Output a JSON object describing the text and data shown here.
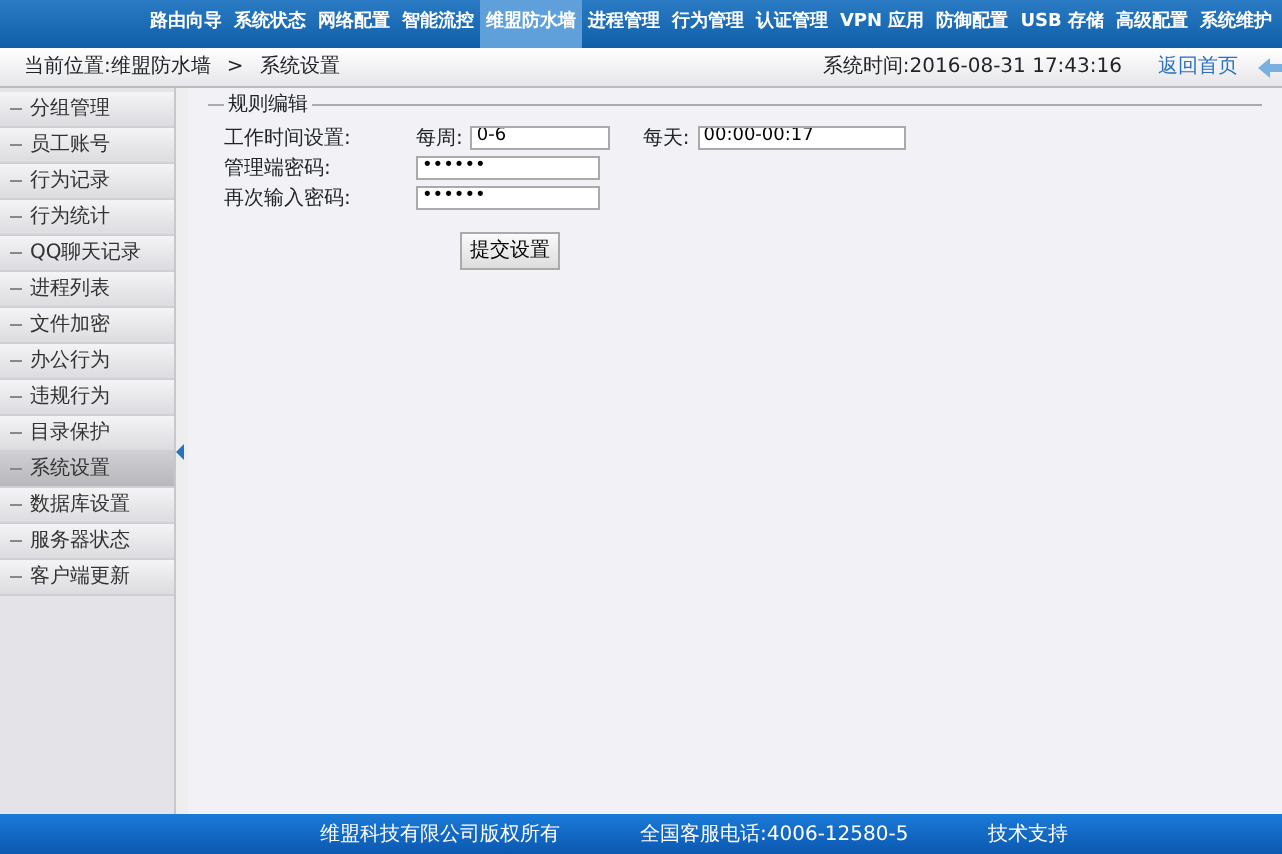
{
  "top_nav": [
    {
      "label": "路由向导",
      "selected": false
    },
    {
      "label": "系统状态",
      "selected": false
    },
    {
      "label": "网络配置",
      "selected": false
    },
    {
      "label": "智能流控",
      "selected": false
    },
    {
      "label": "维盟防水墙",
      "selected": true
    },
    {
      "label": "进程管理",
      "selected": false
    },
    {
      "label": "行为管理",
      "selected": false
    },
    {
      "label": "认证管理",
      "selected": false
    },
    {
      "label": "VPN 应用",
      "selected": false
    },
    {
      "label": "防御配置",
      "selected": false
    },
    {
      "label": "USB 存储",
      "selected": false
    },
    {
      "label": "高级配置",
      "selected": false
    },
    {
      "label": "系统维护",
      "selected": false
    }
  ],
  "breadcrumb": {
    "location": "当前位置:维盟防水墙",
    "separator": ">",
    "page": "系统设置",
    "system_time": "系统时间:2016-08-31 17:43:16",
    "home_link": "返回首页"
  },
  "sidebar": {
    "items": [
      {
        "label": "分组管理",
        "selected": false
      },
      {
        "label": "员工账号",
        "selected": false
      },
      {
        "label": "行为记录",
        "selected": false
      },
      {
        "label": "行为统计",
        "selected": false
      },
      {
        "label": "QQ聊天记录",
        "selected": false
      },
      {
        "label": "进程列表",
        "selected": false
      },
      {
        "label": "文件加密",
        "selected": false
      },
      {
        "label": "办公行为",
        "selected": false
      },
      {
        "label": "违规行为",
        "selected": false
      },
      {
        "label": "目录保护",
        "selected": false
      },
      {
        "label": "系统设置",
        "selected": true
      },
      {
        "label": "数据库设置",
        "selected": false
      },
      {
        "label": "服务器状态",
        "selected": false
      },
      {
        "label": "客户端更新",
        "selected": false
      }
    ]
  },
  "form": {
    "legend": "规则编辑",
    "work_time": {
      "label": "工作时间设置:",
      "week_label": "每周:",
      "week_value": "0-6",
      "day_label": "每天:",
      "day_value": "00:00-00:17"
    },
    "admin_password": {
      "label": "管理端密码:",
      "value": "••••••"
    },
    "confirm_password": {
      "label": "再次输入密码:",
      "value": "••••••"
    },
    "submit": "提交设置"
  },
  "footer": {
    "copyright": "维盟科技有限公司版权所有",
    "hotline": "全国客服电话:4006-12580-5",
    "support": "技术支持"
  }
}
